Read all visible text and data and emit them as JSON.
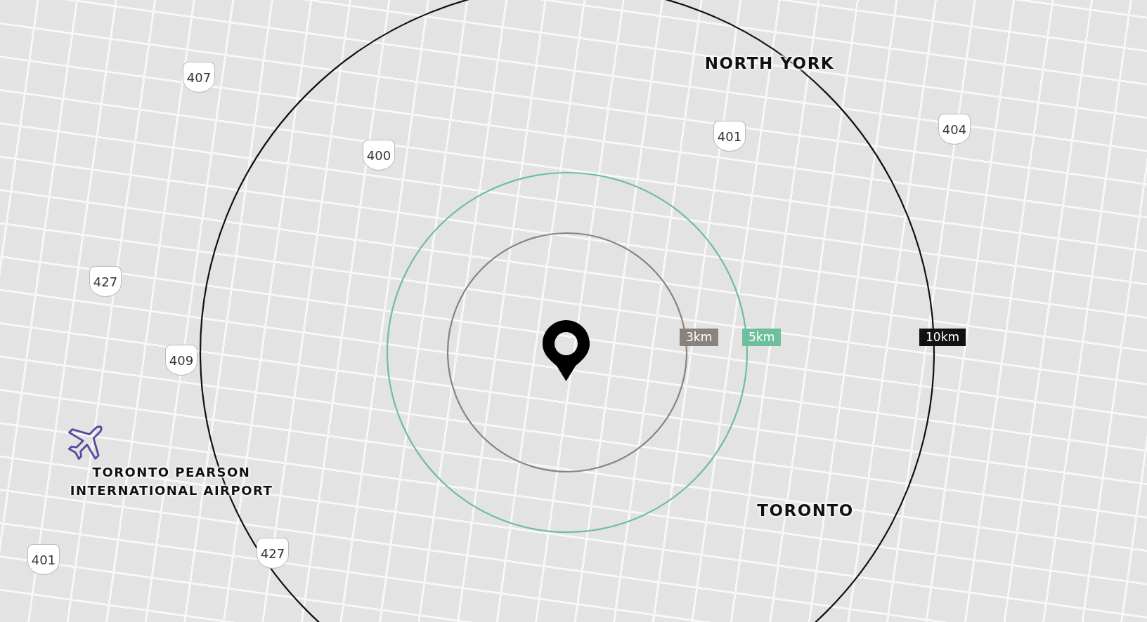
{
  "rings": [
    {
      "label": "3km",
      "color": "#8a827d"
    },
    {
      "label": "5km",
      "color": "#6dbf9e"
    },
    {
      "label": "10km",
      "color": "#111111"
    }
  ],
  "shields": [
    "407",
    "400",
    "401",
    "404",
    "427",
    "409",
    "427",
    "401"
  ],
  "places": [
    {
      "kind": "district",
      "name": "NORTH YORK"
    },
    {
      "kind": "district",
      "name": "TORONTO"
    },
    {
      "kind": "airport",
      "name": "TORONTO PEARSON\nINTERNATIONAL AIRPORT"
    }
  ]
}
